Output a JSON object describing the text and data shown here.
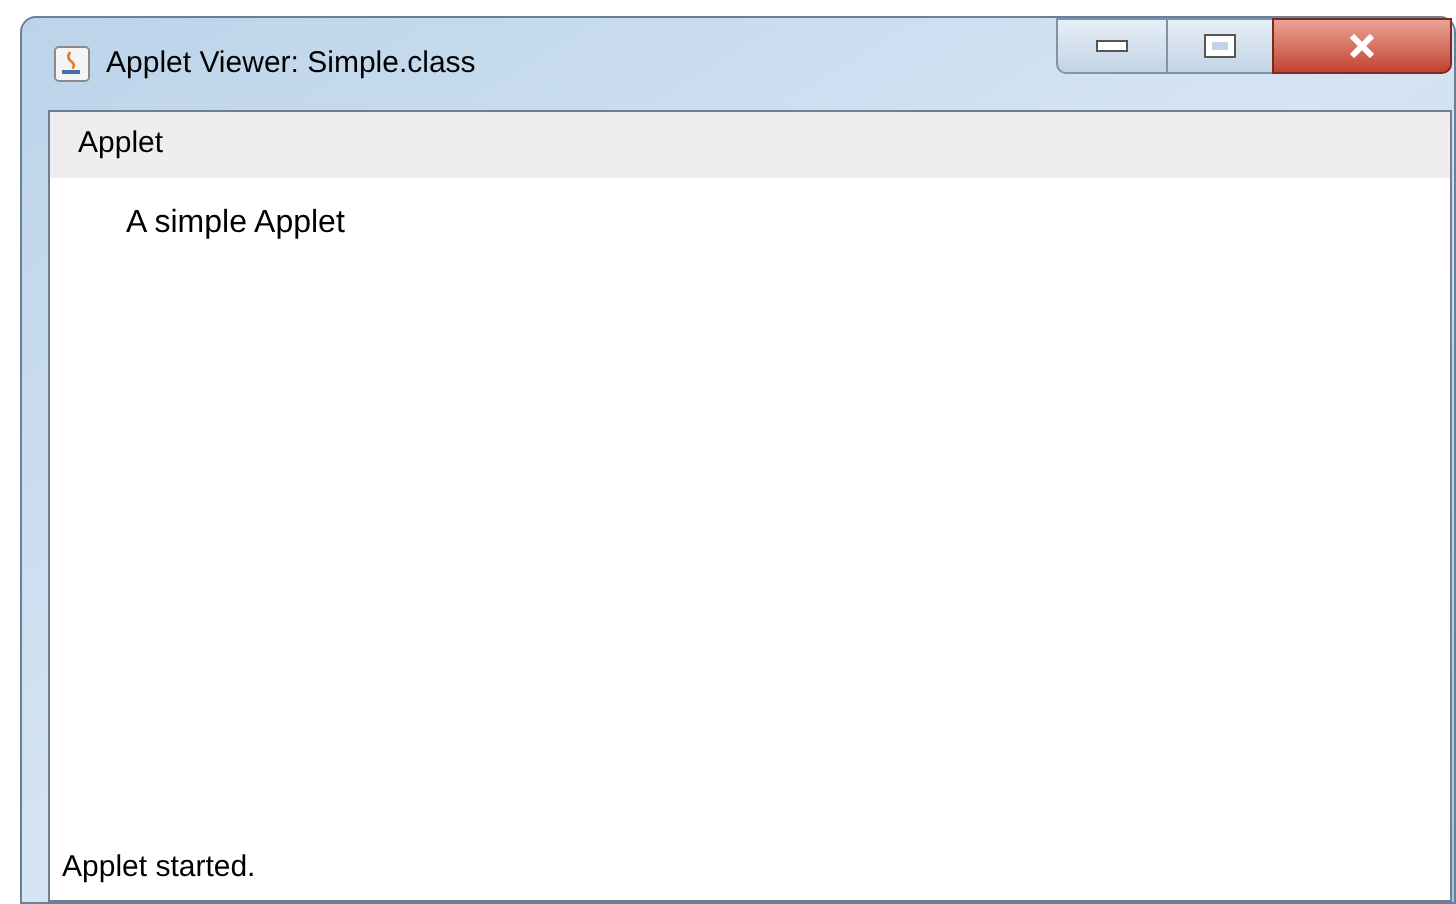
{
  "window": {
    "title": "Applet Viewer: Simple.class"
  },
  "menu_bar": {
    "items": [
      "Applet"
    ]
  },
  "applet": {
    "text": "A simple Applet"
  },
  "status_bar": {
    "text": "Applet started."
  }
}
